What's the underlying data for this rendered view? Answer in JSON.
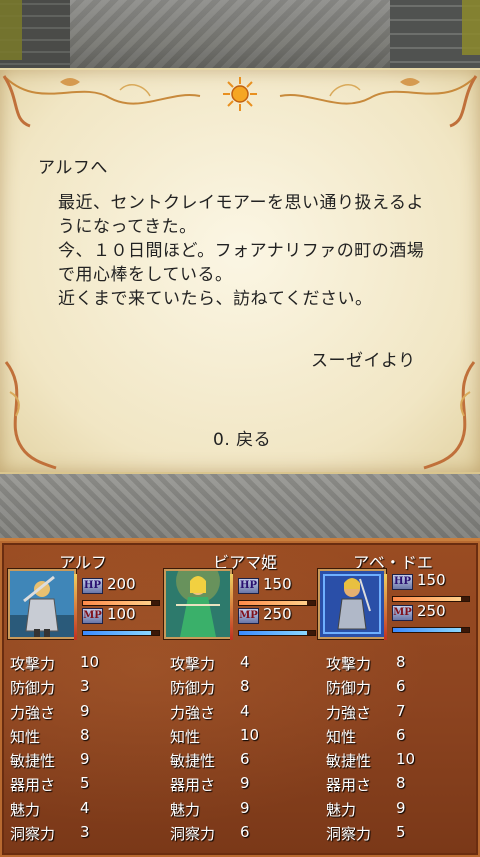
{
  "letter": {
    "salutation": "アルフへ",
    "lines": [
      "最近、セントクレイモアーを思い通り扱えるよ",
      "うになってきた。",
      "今、１０日間ほど。フォアナリファの町の酒場",
      "で用心棒をしている。",
      "近くまで来ていたら、訪ねてください。"
    ],
    "signature": "スーゼイより",
    "back_option": "0. 戻る"
  },
  "party": [
    {
      "name": "アルフ",
      "hp_tag": "HP",
      "hp": "200",
      "hp_fill": 0.9,
      "mp_tag": "MP",
      "mp": "100",
      "mp_fill": 0.9,
      "stats": [
        {
          "label": "攻撃力",
          "value": "10"
        },
        {
          "label": "防御力",
          "value": "3"
        },
        {
          "label": "力強さ",
          "value": "9"
        },
        {
          "label": "知性",
          "value": "8"
        },
        {
          "label": "敏捷性",
          "value": "9"
        },
        {
          "label": "器用さ",
          "value": "5"
        },
        {
          "label": "魅力",
          "value": "4"
        },
        {
          "label": "洞察力",
          "value": "3"
        }
      ]
    },
    {
      "name": "ビアマ姫",
      "hp_tag": "HP",
      "hp": "150",
      "hp_fill": 0.9,
      "mp_tag": "MP",
      "mp": "250",
      "mp_fill": 0.9,
      "stats": [
        {
          "label": "攻撃力",
          "value": "4"
        },
        {
          "label": "防御力",
          "value": "8"
        },
        {
          "label": "力強さ",
          "value": "4"
        },
        {
          "label": "知性",
          "value": "10"
        },
        {
          "label": "敏捷性",
          "value": "6"
        },
        {
          "label": "器用さ",
          "value": "9"
        },
        {
          "label": "魅力",
          "value": "9"
        },
        {
          "label": "洞察力",
          "value": "6"
        }
      ]
    },
    {
      "name": "アベ・ドエ",
      "hp_tag": "HP",
      "hp": "150",
      "hp_fill": 0.9,
      "mp_tag": "MP",
      "mp": "250",
      "mp_fill": 0.9,
      "stats": [
        {
          "label": "攻撃力",
          "value": "8"
        },
        {
          "label": "防御力",
          "value": "6"
        },
        {
          "label": "力強さ",
          "value": "7"
        },
        {
          "label": "知性",
          "value": "6"
        },
        {
          "label": "敏捷性",
          "value": "10"
        },
        {
          "label": "器用さ",
          "value": "8"
        },
        {
          "label": "魅力",
          "value": "9"
        },
        {
          "label": "洞察力",
          "value": "5"
        }
      ]
    }
  ]
}
